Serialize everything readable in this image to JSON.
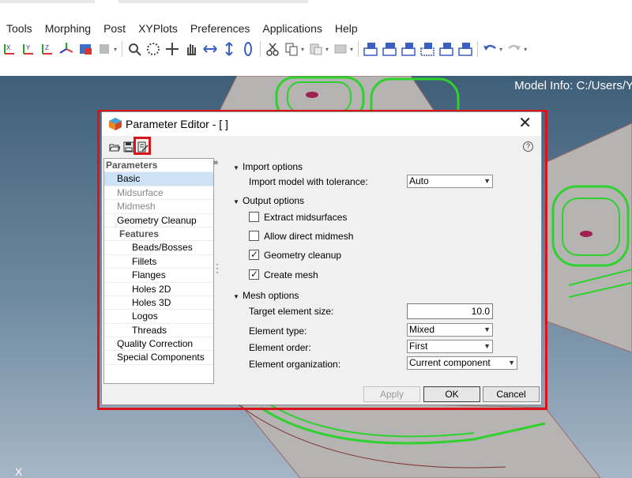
{
  "menubar": [
    "Tools",
    "Morphing",
    "Post",
    "XYPlots",
    "Preferences",
    "Applications",
    "Help"
  ],
  "toolbar_icons": [
    "view-x-axis-icon",
    "view-y-axis-icon",
    "view-z-axis-icon",
    "view-iso-icon",
    "color-icon",
    "select-icon",
    "zoom-icon",
    "zoom-area-icon",
    "rotate-icon",
    "pan-icon",
    "move-horizontal-icon",
    "move-vertical-icon",
    "spin-icon",
    "cut-icon",
    "copy-icon",
    "paste-icon",
    "edit-icon",
    "render-icon",
    "display-1-icon",
    "display-2-icon",
    "display-3-icon",
    "display-4-icon",
    "display-5-icon",
    "display-6-icon",
    "undo-icon",
    "redo-icon"
  ],
  "viewport": {
    "model_info": "Model Info: C:/Users/Y",
    "axis_label": "X"
  },
  "dialog": {
    "title": "Parameter Editor - [ ]",
    "close": "✕",
    "help": "?",
    "collapse": "»",
    "tree": {
      "header": "Parameters",
      "items": [
        {
          "label": "Basic",
          "state": "selected"
        },
        {
          "label": "Midsurface",
          "state": "disabled"
        },
        {
          "label": "Midmesh",
          "state": "disabled"
        },
        {
          "label": "Geometry Cleanup",
          "state": "normal"
        },
        {
          "label": "Features",
          "state": "subheader"
        },
        {
          "label": "Beads/Bosses",
          "state": "sub"
        },
        {
          "label": "Fillets",
          "state": "sub"
        },
        {
          "label": "Flanges",
          "state": "sub"
        },
        {
          "label": "Holes 2D",
          "state": "sub"
        },
        {
          "label": "Holes 3D",
          "state": "sub"
        },
        {
          "label": "Logos",
          "state": "sub"
        },
        {
          "label": "Threads",
          "state": "sub"
        },
        {
          "label": "Quality Correction",
          "state": "normal"
        },
        {
          "label": "Special Components",
          "state": "normal"
        }
      ]
    },
    "import_options": {
      "header": "Import options",
      "tolerance_label": "Import model with tolerance:",
      "tolerance_value": "Auto"
    },
    "output_options": {
      "header": "Output options",
      "extract_midsurfaces": {
        "label": "Extract midsurfaces",
        "checked": false
      },
      "allow_direct_midmesh": {
        "label": "Allow direct midmesh",
        "checked": false
      },
      "geometry_cleanup": {
        "label": "Geometry cleanup",
        "checked": true
      },
      "create_mesh": {
        "label": "Create mesh",
        "checked": true
      }
    },
    "mesh_options": {
      "header": "Mesh options",
      "target_size_label": "Target element size:",
      "target_size_value": "10.0",
      "element_type_label": "Element type:",
      "element_type_value": "Mixed",
      "element_order_label": "Element order:",
      "element_order_value": "First",
      "element_org_label": "Element organization:",
      "element_org_value": "Current component"
    },
    "buttons": {
      "apply": "Apply",
      "ok": "OK",
      "cancel": "Cancel"
    }
  },
  "colors": {
    "highlight_red": "#d9141b",
    "selected_row": "#cde3f5",
    "mesh_green": "#2fd12f"
  }
}
